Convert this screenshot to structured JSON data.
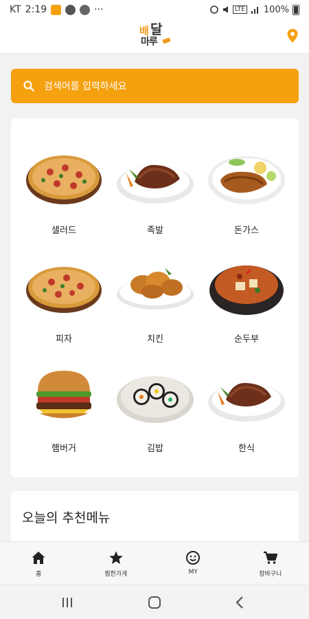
{
  "status_bar": {
    "carrier": "KT",
    "time": "2:19",
    "dots": "···",
    "network": "LTE",
    "battery": "100%"
  },
  "header": {
    "logo_text_1": "배",
    "logo_text_2": "달",
    "logo_text_3": "마루",
    "location_icon": "location-pin-icon"
  },
  "search": {
    "placeholder": "검색어를 입력하세요",
    "icon": "search-icon"
  },
  "categories": [
    {
      "label": "샐러드",
      "image": "pizza-image"
    },
    {
      "label": "족발",
      "image": "jokbal-image"
    },
    {
      "label": "돈가스",
      "image": "tonkatsu-image"
    },
    {
      "label": "피자",
      "image": "pizza-image"
    },
    {
      "label": "치킨",
      "image": "fried-chicken-image"
    },
    {
      "label": "순두부",
      "image": "sundubu-stew-image"
    },
    {
      "label": "햄버거",
      "image": "hamburger-image"
    },
    {
      "label": "김밥",
      "image": "kimbap-image"
    },
    {
      "label": "한식",
      "image": "jokbal-image"
    }
  ],
  "recommend": {
    "title": "오늘의 추천메뉴"
  },
  "bottom_nav": [
    {
      "label": "홈",
      "icon": "home-icon"
    },
    {
      "label": "찜한가게",
      "icon": "star-icon"
    },
    {
      "label": "MY",
      "icon": "smiley-icon"
    },
    {
      "label": "장바구니",
      "icon": "cart-icon"
    }
  ],
  "colors": {
    "accent": "#f5a00f",
    "background": "#f2f2f2",
    "card": "#ffffff"
  }
}
